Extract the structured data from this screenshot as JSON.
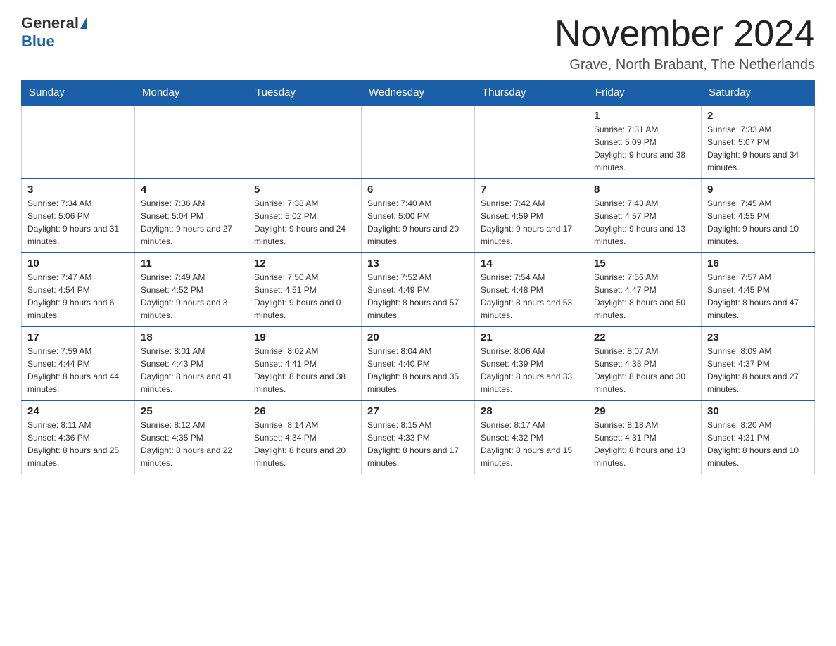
{
  "logo": {
    "general": "General",
    "blue": "Blue"
  },
  "title": "November 2024",
  "subtitle": "Grave, North Brabant, The Netherlands",
  "days_of_week": [
    "Sunday",
    "Monday",
    "Tuesday",
    "Wednesday",
    "Thursday",
    "Friday",
    "Saturday"
  ],
  "weeks": [
    [
      {
        "day": "",
        "info": ""
      },
      {
        "day": "",
        "info": ""
      },
      {
        "day": "",
        "info": ""
      },
      {
        "day": "",
        "info": ""
      },
      {
        "day": "",
        "info": ""
      },
      {
        "day": "1",
        "info": "Sunrise: 7:31 AM\nSunset: 5:09 PM\nDaylight: 9 hours and 38 minutes."
      },
      {
        "day": "2",
        "info": "Sunrise: 7:33 AM\nSunset: 5:07 PM\nDaylight: 9 hours and 34 minutes."
      }
    ],
    [
      {
        "day": "3",
        "info": "Sunrise: 7:34 AM\nSunset: 5:06 PM\nDaylight: 9 hours and 31 minutes."
      },
      {
        "day": "4",
        "info": "Sunrise: 7:36 AM\nSunset: 5:04 PM\nDaylight: 9 hours and 27 minutes."
      },
      {
        "day": "5",
        "info": "Sunrise: 7:38 AM\nSunset: 5:02 PM\nDaylight: 9 hours and 24 minutes."
      },
      {
        "day": "6",
        "info": "Sunrise: 7:40 AM\nSunset: 5:00 PM\nDaylight: 9 hours and 20 minutes."
      },
      {
        "day": "7",
        "info": "Sunrise: 7:42 AM\nSunset: 4:59 PM\nDaylight: 9 hours and 17 minutes."
      },
      {
        "day": "8",
        "info": "Sunrise: 7:43 AM\nSunset: 4:57 PM\nDaylight: 9 hours and 13 minutes."
      },
      {
        "day": "9",
        "info": "Sunrise: 7:45 AM\nSunset: 4:55 PM\nDaylight: 9 hours and 10 minutes."
      }
    ],
    [
      {
        "day": "10",
        "info": "Sunrise: 7:47 AM\nSunset: 4:54 PM\nDaylight: 9 hours and 6 minutes."
      },
      {
        "day": "11",
        "info": "Sunrise: 7:49 AM\nSunset: 4:52 PM\nDaylight: 9 hours and 3 minutes."
      },
      {
        "day": "12",
        "info": "Sunrise: 7:50 AM\nSunset: 4:51 PM\nDaylight: 9 hours and 0 minutes."
      },
      {
        "day": "13",
        "info": "Sunrise: 7:52 AM\nSunset: 4:49 PM\nDaylight: 8 hours and 57 minutes."
      },
      {
        "day": "14",
        "info": "Sunrise: 7:54 AM\nSunset: 4:48 PM\nDaylight: 8 hours and 53 minutes."
      },
      {
        "day": "15",
        "info": "Sunrise: 7:56 AM\nSunset: 4:47 PM\nDaylight: 8 hours and 50 minutes."
      },
      {
        "day": "16",
        "info": "Sunrise: 7:57 AM\nSunset: 4:45 PM\nDaylight: 8 hours and 47 minutes."
      }
    ],
    [
      {
        "day": "17",
        "info": "Sunrise: 7:59 AM\nSunset: 4:44 PM\nDaylight: 8 hours and 44 minutes."
      },
      {
        "day": "18",
        "info": "Sunrise: 8:01 AM\nSunset: 4:43 PM\nDaylight: 8 hours and 41 minutes."
      },
      {
        "day": "19",
        "info": "Sunrise: 8:02 AM\nSunset: 4:41 PM\nDaylight: 8 hours and 38 minutes."
      },
      {
        "day": "20",
        "info": "Sunrise: 8:04 AM\nSunset: 4:40 PM\nDaylight: 8 hours and 35 minutes."
      },
      {
        "day": "21",
        "info": "Sunrise: 8:06 AM\nSunset: 4:39 PM\nDaylight: 8 hours and 33 minutes."
      },
      {
        "day": "22",
        "info": "Sunrise: 8:07 AM\nSunset: 4:38 PM\nDaylight: 8 hours and 30 minutes."
      },
      {
        "day": "23",
        "info": "Sunrise: 8:09 AM\nSunset: 4:37 PM\nDaylight: 8 hours and 27 minutes."
      }
    ],
    [
      {
        "day": "24",
        "info": "Sunrise: 8:11 AM\nSunset: 4:36 PM\nDaylight: 8 hours and 25 minutes."
      },
      {
        "day": "25",
        "info": "Sunrise: 8:12 AM\nSunset: 4:35 PM\nDaylight: 8 hours and 22 minutes."
      },
      {
        "day": "26",
        "info": "Sunrise: 8:14 AM\nSunset: 4:34 PM\nDaylight: 8 hours and 20 minutes."
      },
      {
        "day": "27",
        "info": "Sunrise: 8:15 AM\nSunset: 4:33 PM\nDaylight: 8 hours and 17 minutes."
      },
      {
        "day": "28",
        "info": "Sunrise: 8:17 AM\nSunset: 4:32 PM\nDaylight: 8 hours and 15 minutes."
      },
      {
        "day": "29",
        "info": "Sunrise: 8:18 AM\nSunset: 4:31 PM\nDaylight: 8 hours and 13 minutes."
      },
      {
        "day": "30",
        "info": "Sunrise: 8:20 AM\nSunset: 4:31 PM\nDaylight: 8 hours and 10 minutes."
      }
    ]
  ]
}
